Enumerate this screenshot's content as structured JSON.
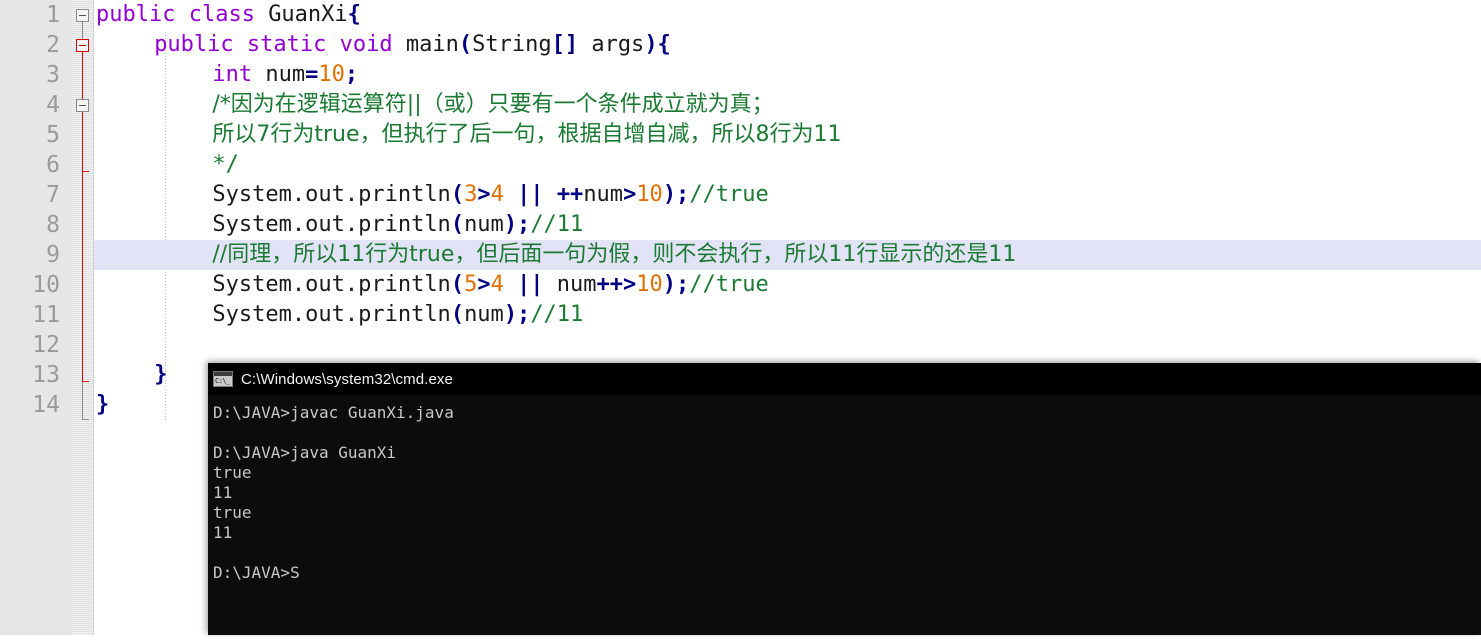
{
  "editor": {
    "background_color": "#ffffff",
    "gutter_color": "#e6e6e6",
    "highlight_color": "#e3e3f7",
    "line_numbers": [
      "1",
      "2",
      "3",
      "4",
      "5",
      "6",
      "7",
      "8",
      "9",
      "10",
      "11",
      "12",
      "13",
      "14"
    ],
    "lines": [
      {
        "n": "1",
        "indent": 0,
        "highlight": false,
        "tokens": [
          {
            "t": "public class ",
            "c": "kw"
          },
          {
            "t": "GuanXi",
            "c": "id"
          },
          {
            "t": "{",
            "c": "op"
          }
        ]
      },
      {
        "n": "2",
        "indent": 4,
        "highlight": false,
        "tokens": [
          {
            "t": "public static void ",
            "c": "kw"
          },
          {
            "t": "main",
            "c": "id"
          },
          {
            "t": "(",
            "c": "op"
          },
          {
            "t": "String",
            "c": "id"
          },
          {
            "t": "[]",
            "c": "op"
          },
          {
            "t": " args",
            "c": "id"
          },
          {
            "t": "){",
            "c": "op"
          }
        ]
      },
      {
        "n": "3",
        "indent": 8,
        "highlight": false,
        "tokens": [
          {
            "t": "int ",
            "c": "kw"
          },
          {
            "t": "num",
            "c": "id"
          },
          {
            "t": "=",
            "c": "op"
          },
          {
            "t": "10",
            "c": "num"
          },
          {
            "t": ";",
            "c": "op"
          }
        ]
      },
      {
        "n": "4",
        "indent": 8,
        "highlight": false,
        "tokens": [
          {
            "t": "/*因为在逻辑运算符||（或）只要有一个条件成立就为真；",
            "c": "cmt-cn"
          }
        ]
      },
      {
        "n": "5",
        "indent": 8,
        "highlight": false,
        "tokens": [
          {
            "t": "所以7行为true，但执行了后一句，根据自增自减，所以8行为11",
            "c": "cmt-cn"
          }
        ]
      },
      {
        "n": "6",
        "indent": 8,
        "highlight": false,
        "tokens": [
          {
            "t": "*/",
            "c": "cmt"
          }
        ]
      },
      {
        "n": "7",
        "indent": 8,
        "highlight": false,
        "tokens": [
          {
            "t": "System.out.println",
            "c": "id"
          },
          {
            "t": "(",
            "c": "op"
          },
          {
            "t": "3",
            "c": "num"
          },
          {
            "t": ">",
            "c": "op"
          },
          {
            "t": "4",
            "c": "num"
          },
          {
            "t": " ",
            "c": "plain"
          },
          {
            "t": "||",
            "c": "op"
          },
          {
            "t": " ",
            "c": "plain"
          },
          {
            "t": "++",
            "c": "op"
          },
          {
            "t": "num",
            "c": "id"
          },
          {
            "t": ">",
            "c": "op"
          },
          {
            "t": "10",
            "c": "num"
          },
          {
            "t": ");",
            "c": "op"
          },
          {
            "t": "//true",
            "c": "cmt"
          }
        ]
      },
      {
        "n": "8",
        "indent": 8,
        "highlight": false,
        "tokens": [
          {
            "t": "System.out.println",
            "c": "id"
          },
          {
            "t": "(",
            "c": "op"
          },
          {
            "t": "num",
            "c": "id"
          },
          {
            "t": ");",
            "c": "op"
          },
          {
            "t": "//11",
            "c": "cmt"
          }
        ]
      },
      {
        "n": "9",
        "indent": 8,
        "highlight": true,
        "tokens": [
          {
            "t": "//同理，所以11行为true，但后面一句为假，则不会执行，所以11行显示的还是11",
            "c": "cmt-cn"
          }
        ]
      },
      {
        "n": "10",
        "indent": 8,
        "highlight": false,
        "tokens": [
          {
            "t": "System.out.println",
            "c": "id"
          },
          {
            "t": "(",
            "c": "op"
          },
          {
            "t": "5",
            "c": "num"
          },
          {
            "t": ">",
            "c": "op"
          },
          {
            "t": "4",
            "c": "num"
          },
          {
            "t": " ",
            "c": "plain"
          },
          {
            "t": "||",
            "c": "op"
          },
          {
            "t": " num",
            "c": "id"
          },
          {
            "t": "++>",
            "c": "op"
          },
          {
            "t": "10",
            "c": "num"
          },
          {
            "t": ");",
            "c": "op"
          },
          {
            "t": "//true",
            "c": "cmt"
          }
        ]
      },
      {
        "n": "11",
        "indent": 8,
        "highlight": false,
        "tokens": [
          {
            "t": "System.out.println",
            "c": "id"
          },
          {
            "t": "(",
            "c": "op"
          },
          {
            "t": "num",
            "c": "id"
          },
          {
            "t": ");",
            "c": "op"
          },
          {
            "t": "//11",
            "c": "cmt"
          }
        ]
      },
      {
        "n": "12",
        "indent": 0,
        "highlight": false,
        "tokens": []
      },
      {
        "n": "13",
        "indent": 4,
        "highlight": false,
        "tokens": [
          {
            "t": "}",
            "c": "op"
          }
        ]
      },
      {
        "n": "14",
        "indent": 0,
        "highlight": false,
        "tokens": [
          {
            "t": "}",
            "c": "op"
          }
        ]
      }
    ],
    "fold_markers": [
      {
        "line": "1",
        "style": "gray"
      },
      {
        "line": "2",
        "style": "red"
      },
      {
        "line": "4",
        "style": "gray"
      }
    ]
  },
  "console": {
    "title": "C:\\Windows\\system32\\cmd.exe",
    "icon": "cmd-icon",
    "background_color": "#0c0c0c",
    "text_color": "#c8c8c8",
    "lines": [
      "D:\\JAVA>javac GuanXi.java",
      "",
      "D:\\JAVA>java GuanXi",
      "true",
      "11",
      "true",
      "11",
      "",
      "D:\\JAVA>S"
    ]
  }
}
